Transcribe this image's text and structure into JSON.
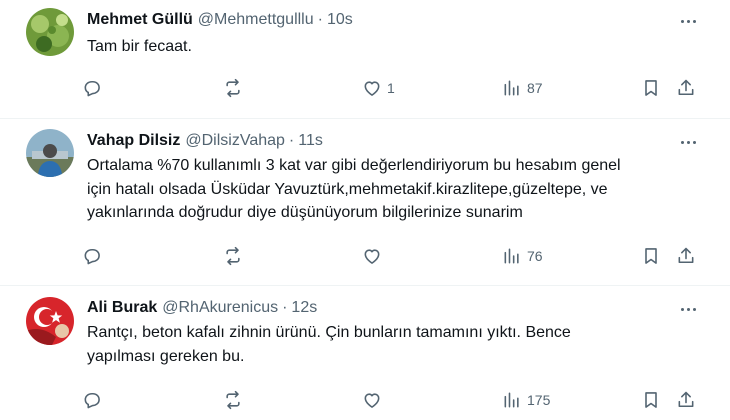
{
  "tweets": [
    {
      "name": "Mehmet Güllü",
      "handle": "@Mehmettgulllu",
      "separator": "·",
      "time": "10s",
      "text": "Tam bir fecaat.",
      "like_count": "1",
      "view_count": "87",
      "avatar_colors": [
        "#6f9a3a",
        "#a6c86a",
        "#3d6b22"
      ]
    },
    {
      "name": "Vahap Dilsiz",
      "handle": "@DilsizVahap",
      "separator": "·",
      "time": "11s",
      "text": "Ortalama %70 kullanımlı 3 kat var gibi değerlendiriyorum bu hesabım genel\niçin hatalı olsada Üsküdar Yavuztürk,mehmetakif.kirazlitepe,güzeltepe, ve\nyakınlarında doğrudur diye düşünüyorum bilgilerinize sunarim",
      "like_count": "",
      "view_count": "76",
      "avatar_colors": [
        "#8fb3c9",
        "#4b4b4b",
        "#2c6fb0"
      ]
    },
    {
      "name": "Ali Burak",
      "handle": "@RhAkurenicus",
      "separator": "·",
      "time": "12s",
      "text": "Rantçı, beton kafalı zihnin ürünü. Çin bunların tamamını yıktı. Bence\nyapılması gereken bu.",
      "like_count": "",
      "view_count": "175",
      "avatar_colors": [
        "#d7252b",
        "#ffffff",
        "#9a1a1e"
      ]
    }
  ]
}
